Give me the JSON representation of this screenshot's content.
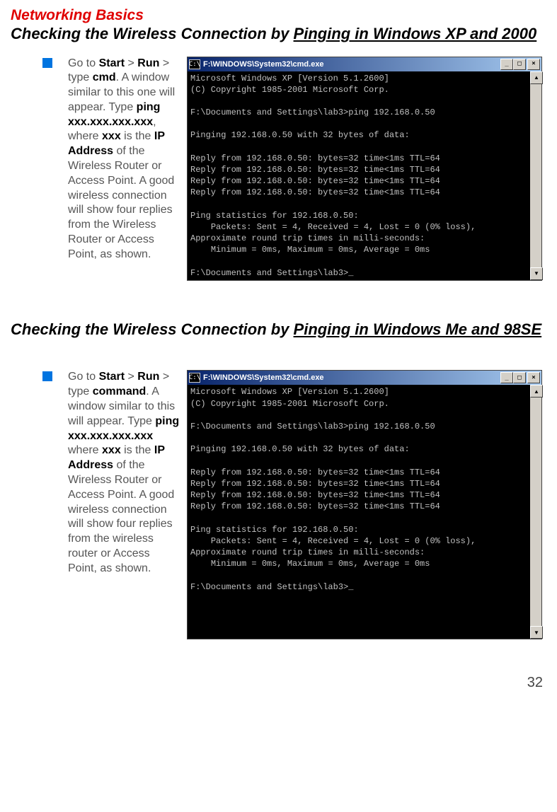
{
  "title_main": "Networking Basics",
  "heading1": {
    "pre": "Checking the Wireless Connection by ",
    "under": "Pinging in Windows XP and 2000"
  },
  "heading2": {
    "pre": "Checking the Wireless Connection by ",
    "under": "Pinging in Windows Me and 98SE"
  },
  "instr1": {
    "t1": "Go to ",
    "b1": "Start",
    "t2": " > ",
    "b2": "Run",
    "t3": " > type ",
    "b3": "cmd",
    "t4": ".  A window similar to this one will appear.  Type ",
    "b4": "ping xxx.xxx.xxx.xxx",
    "t5": ", where ",
    "b5": "xxx",
    "t6": " is the ",
    "b6": "IP Address",
    "t7": " of the Wireless Router or Access Point.  A good wireless connection will show four replies from the Wireless Router or Access Point, as shown."
  },
  "instr2": {
    "t1": "Go to ",
    "b1": "Start",
    "t2": " > ",
    "b2": "Run",
    "t3": " > type ",
    "b3": "command",
    "t4": ".  A window similar to this will appear.  Type ",
    "b4": "ping xxx.xxx.xxx.xxx",
    "t5": " where ",
    "b5": "xxx",
    "t6": " is the ",
    "b6": "IP Address",
    "t7": " of the Wireless Router or Access Point.  A good wireless connection will show four replies from the wireless router or Access Point, as shown."
  },
  "cmd1": {
    "icon_text": "C:\\",
    "title": "F:\\WINDOWS\\System32\\cmd.exe",
    "body": "Microsoft Windows XP [Version 5.1.2600]\n(C) Copyright 1985-2001 Microsoft Corp.\n\nF:\\Documents and Settings\\lab3>ping 192.168.0.50\n\nPinging 192.168.0.50 with 32 bytes of data:\n\nReply from 192.168.0.50: bytes=32 time<1ms TTL=64\nReply from 192.168.0.50: bytes=32 time<1ms TTL=64\nReply from 192.168.0.50: bytes=32 time<1ms TTL=64\nReply from 192.168.0.50: bytes=32 time<1ms TTL=64\n\nPing statistics for 192.168.0.50:\n    Packets: Sent = 4, Received = 4, Lost = 0 (0% loss),\nApproximate round trip times in milli-seconds:\n    Minimum = 0ms, Maximum = 0ms, Average = 0ms\n\nF:\\Documents and Settings\\lab3>_"
  },
  "cmd2": {
    "icon_text": "C:\\",
    "title": "F:\\WINDOWS\\System32\\cmd.exe",
    "body": "Microsoft Windows XP [Version 5.1.2600]\n(C) Copyright 1985-2001 Microsoft Corp.\n\nF:\\Documents and Settings\\lab3>ping 192.168.0.50\n\nPinging 192.168.0.50 with 32 bytes of data:\n\nReply from 192.168.0.50: bytes=32 time<1ms TTL=64\nReply from 192.168.0.50: bytes=32 time<1ms TTL=64\nReply from 192.168.0.50: bytes=32 time<1ms TTL=64\nReply from 192.168.0.50: bytes=32 time<1ms TTL=64\n\nPing statistics for 192.168.0.50:\n    Packets: Sent = 4, Received = 4, Lost = 0 (0% loss),\nApproximate round trip times in milli-seconds:\n    Minimum = 0ms, Maximum = 0ms, Average = 0ms\n\nF:\\Documents and Settings\\lab3>_"
  },
  "btn_min": "_",
  "btn_max": "□",
  "btn_close": "×",
  "scroll_up": "▲",
  "scroll_down": "▼",
  "page_number": "32"
}
